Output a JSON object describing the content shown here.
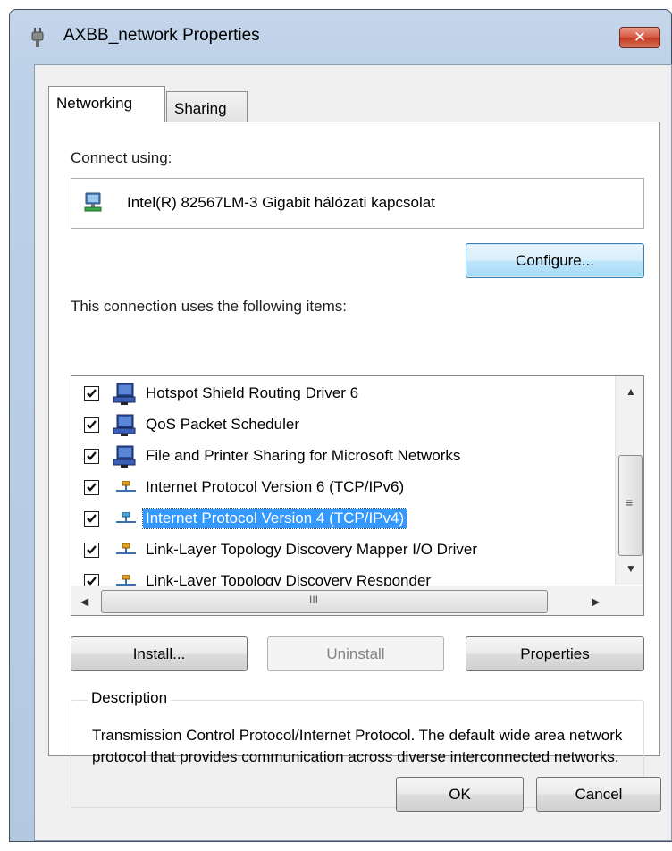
{
  "window": {
    "title": "AXBB_network Properties",
    "close_glyph": "✕"
  },
  "tabs": [
    {
      "label": "Networking",
      "active": true
    },
    {
      "label": "Sharing",
      "active": false
    }
  ],
  "connect": {
    "label": "Connect using:",
    "adapter_name": "Intel(R) 82567LM-3 Gigabit hálózati kapcsolat",
    "adapter_icon": "network-adapter-icon",
    "configure_label": "Configure..."
  },
  "items": {
    "label": "This connection uses the following items:",
    "list": [
      {
        "label": "Hotspot Shield Routing Driver 6",
        "checked": true,
        "icon": "computer-network-icon",
        "selected": false
      },
      {
        "label": "QoS Packet Scheduler",
        "checked": true,
        "icon": "computer-network-icon",
        "selected": false
      },
      {
        "label": "File and Printer Sharing for Microsoft Networks",
        "checked": true,
        "icon": "computer-network-icon",
        "selected": false
      },
      {
        "label": "Internet Protocol Version 6 (TCP/IPv6)",
        "checked": true,
        "icon": "protocol-icon",
        "selected": false
      },
      {
        "label": "Internet Protocol Version 4 (TCP/IPv4)",
        "checked": true,
        "icon": "protocol-icon",
        "selected": true
      },
      {
        "label": "Link-Layer Topology Discovery Mapper I/O Driver",
        "checked": true,
        "icon": "protocol-icon",
        "selected": false
      },
      {
        "label": "Link-Layer Topology Discovery Responder",
        "checked": true,
        "icon": "protocol-icon",
        "selected": false
      }
    ],
    "scroll_glyphs": {
      "up": "▲",
      "down": "▼",
      "left": "◀",
      "right": "▶",
      "vgrip": "≡",
      "hgrip": "III"
    }
  },
  "buttons": {
    "install": "Install...",
    "uninstall": "Uninstall",
    "properties": "Properties",
    "ok": "OK",
    "cancel": "Cancel"
  },
  "description": {
    "legend": "Description",
    "text": "Transmission Control Protocol/Internet Protocol. The default wide area network protocol that provides communication across diverse interconnected networks."
  },
  "colors": {
    "selection": "#3399ff",
    "close_button": "#c23a20",
    "window_frame": "#bdd1e8"
  }
}
